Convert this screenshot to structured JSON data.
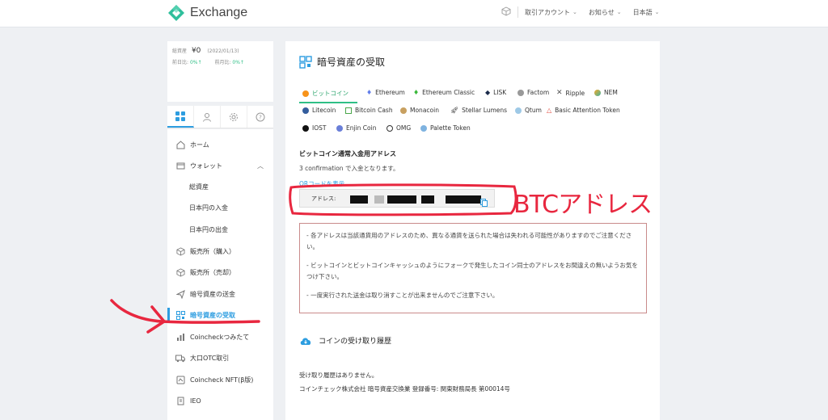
{
  "header": {
    "app_title": "Exchange",
    "nav": [
      {
        "label": "取引アカウント"
      },
      {
        "label": "お知らせ"
      },
      {
        "label": "日本語"
      }
    ]
  },
  "sidebar": {
    "balance_label": "総資産",
    "balance_value": "¥0",
    "balance_date": "(2022/01/13)",
    "prev_day_label": "前日比",
    "prev_day_value": "0%",
    "prev_month_label": "前月比",
    "prev_month_value": "0%",
    "items": [
      {
        "label": "ホーム",
        "icon": "home-icon"
      },
      {
        "label": "ウォレット",
        "icon": "wallet-icon"
      },
      {
        "label": "総資産"
      },
      {
        "label": "日本円の入金"
      },
      {
        "label": "日本円の出金"
      },
      {
        "label": "販売所（購入）",
        "icon": "cube-icon"
      },
      {
        "label": "販売所（売却）",
        "icon": "cube-icon"
      },
      {
        "label": "暗号資産の送金",
        "icon": "send-icon"
      },
      {
        "label": "暗号資産の受取",
        "icon": "qr-icon"
      },
      {
        "label": "Coincheckつみたて",
        "icon": "chart-icon"
      },
      {
        "label": "大口OTC取引",
        "icon": "truck-icon"
      },
      {
        "label": "Coincheck NFT(β版)",
        "icon": "nft-icon"
      },
      {
        "label": "IEO",
        "icon": "ieo-icon"
      }
    ]
  },
  "main": {
    "title": "暗号資産の受取",
    "coins": [
      {
        "label": "ビットコイン",
        "color": "#f7931a"
      },
      {
        "label": "Ethereum",
        "color": "#627eea"
      },
      {
        "label": "Ethereum Classic",
        "color": "#3ab83a"
      },
      {
        "label": "LISK",
        "color": "#1a2a4a"
      },
      {
        "label": "Factom",
        "color": "#888888"
      },
      {
        "label": "Ripple",
        "color": "#555555"
      },
      {
        "label": "NEM",
        "color": "#3cb4a4"
      },
      {
        "label": "Litecoin",
        "color": "#345d9d"
      },
      {
        "label": "Bitcoin Cash",
        "color": "#4aa64a"
      },
      {
        "label": "Monacoin",
        "color": "#c8a060"
      },
      {
        "label": "Stellar Lumens",
        "color": "#222222"
      },
      {
        "label": "Qtum",
        "color": "#2e9ad0"
      },
      {
        "label": "Basic Attention Token",
        "color": "#e0473b"
      },
      {
        "label": "IOST",
        "color": "#111111"
      },
      {
        "label": "Enjin Coin",
        "color": "#6a7fd8"
      },
      {
        "label": "OMG",
        "color": "#333333"
      },
      {
        "label": "Palette Token",
        "color": "#7fb3e0"
      }
    ],
    "address_title": "ビットコイン通常入金用アドレス",
    "confirmation_text": "3 confirmation で入金となります。",
    "qr_link": "QRコードを表示",
    "address_label": "アドレス:",
    "notices": [
      "- 各アドレスは当該通貨用のアドレスのため、異なる通貨を送られた場合は失われる可能性がありますのでご注意ください。",
      "- ビットコインとビットコインキャッシュのようにフォークで発生したコイン同士のアドレスをお間違えの無いようお気をつけ下さい。",
      "- 一度実行された送金は取り消すことが出来ませんのでご注意下さい。"
    ],
    "history_title": "コインの受け取り履歴",
    "no_history": "受け取り履歴はありません。",
    "company": "コインチェック株式会社 暗号資産交換業 登録番号: 関東財務局長 第00014号"
  },
  "annotation": {
    "label": "BTCアドレス",
    "color": "#e8273f"
  }
}
